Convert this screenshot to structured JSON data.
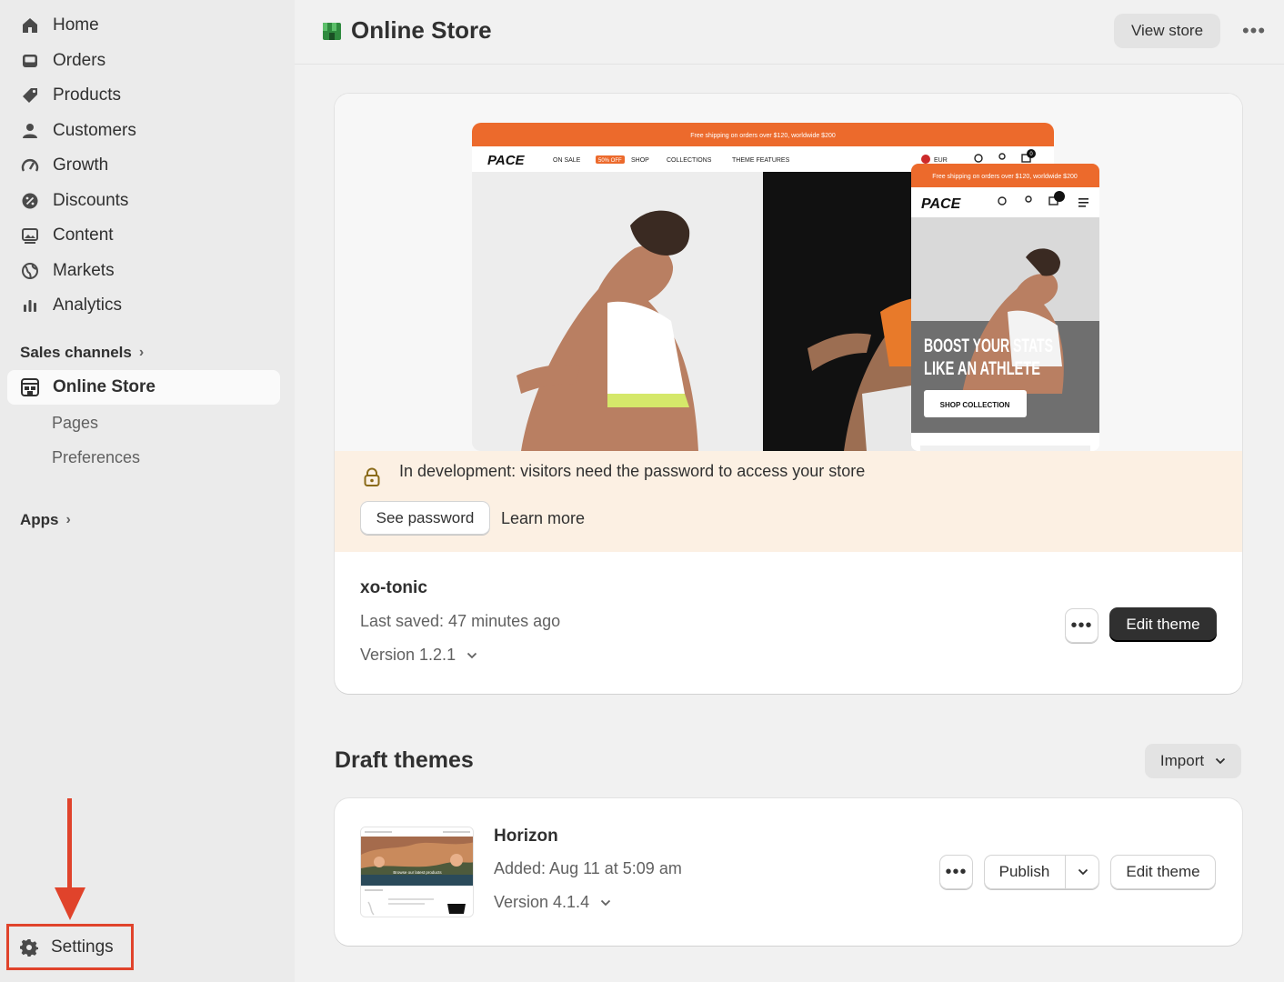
{
  "sidebar": {
    "items": [
      {
        "label": "Home",
        "icon": "home-icon"
      },
      {
        "label": "Orders",
        "icon": "inbox-icon"
      },
      {
        "label": "Products",
        "icon": "tag-icon"
      },
      {
        "label": "Customers",
        "icon": "person-icon"
      },
      {
        "label": "Growth",
        "icon": "gauge-icon"
      },
      {
        "label": "Discounts",
        "icon": "discount-icon"
      },
      {
        "label": "Content",
        "icon": "image-icon"
      },
      {
        "label": "Markets",
        "icon": "globe-icon"
      },
      {
        "label": "Analytics",
        "icon": "bar-chart-icon"
      }
    ],
    "sales_channels_label": "Sales channels",
    "online_store_label": "Online Store",
    "sub_items": [
      "Pages",
      "Preferences"
    ],
    "apps_label": "Apps",
    "settings_label": "Settings"
  },
  "header": {
    "title": "Online Store",
    "view_store": "View store",
    "more": "•••"
  },
  "preview": {
    "promo_text": "Free shipping on orders over $120, worldwide $200",
    "brand": "PACE",
    "nav": [
      "ON SALE",
      "SHOP",
      "COLLECTIONS",
      "THEME FEATURES"
    ],
    "sale_badge": "50% OFF",
    "currency": "EUR",
    "cart_count": "0",
    "headline_1": "BOOST YOUR STATS",
    "headline_2": "LIKE AN ATHLETE",
    "cta": "SHOP COLLECTION"
  },
  "banner": {
    "text": "In development: visitors need the password to access your store",
    "see_password": "See password",
    "learn_more": "Learn more"
  },
  "current_theme": {
    "name": "xo-tonic",
    "last_saved": "Last saved: 47 minutes ago",
    "version": "Version 1.2.1",
    "more": "•••",
    "edit": "Edit theme"
  },
  "drafts": {
    "title": "Draft themes",
    "import": "Import",
    "theme": {
      "name": "Horizon",
      "added": "Added: Aug 11 at 5:09 am",
      "version": "Version 4.1.4",
      "more": "•••",
      "publish": "Publish",
      "edit": "Edit theme",
      "thumb_caption": "Browse our latest products"
    }
  },
  "colors": {
    "accent_red": "#e0432b",
    "promo_orange": "#ec6a2c",
    "banner_bg": "#fcf0e3",
    "primary_button": "#303030"
  }
}
